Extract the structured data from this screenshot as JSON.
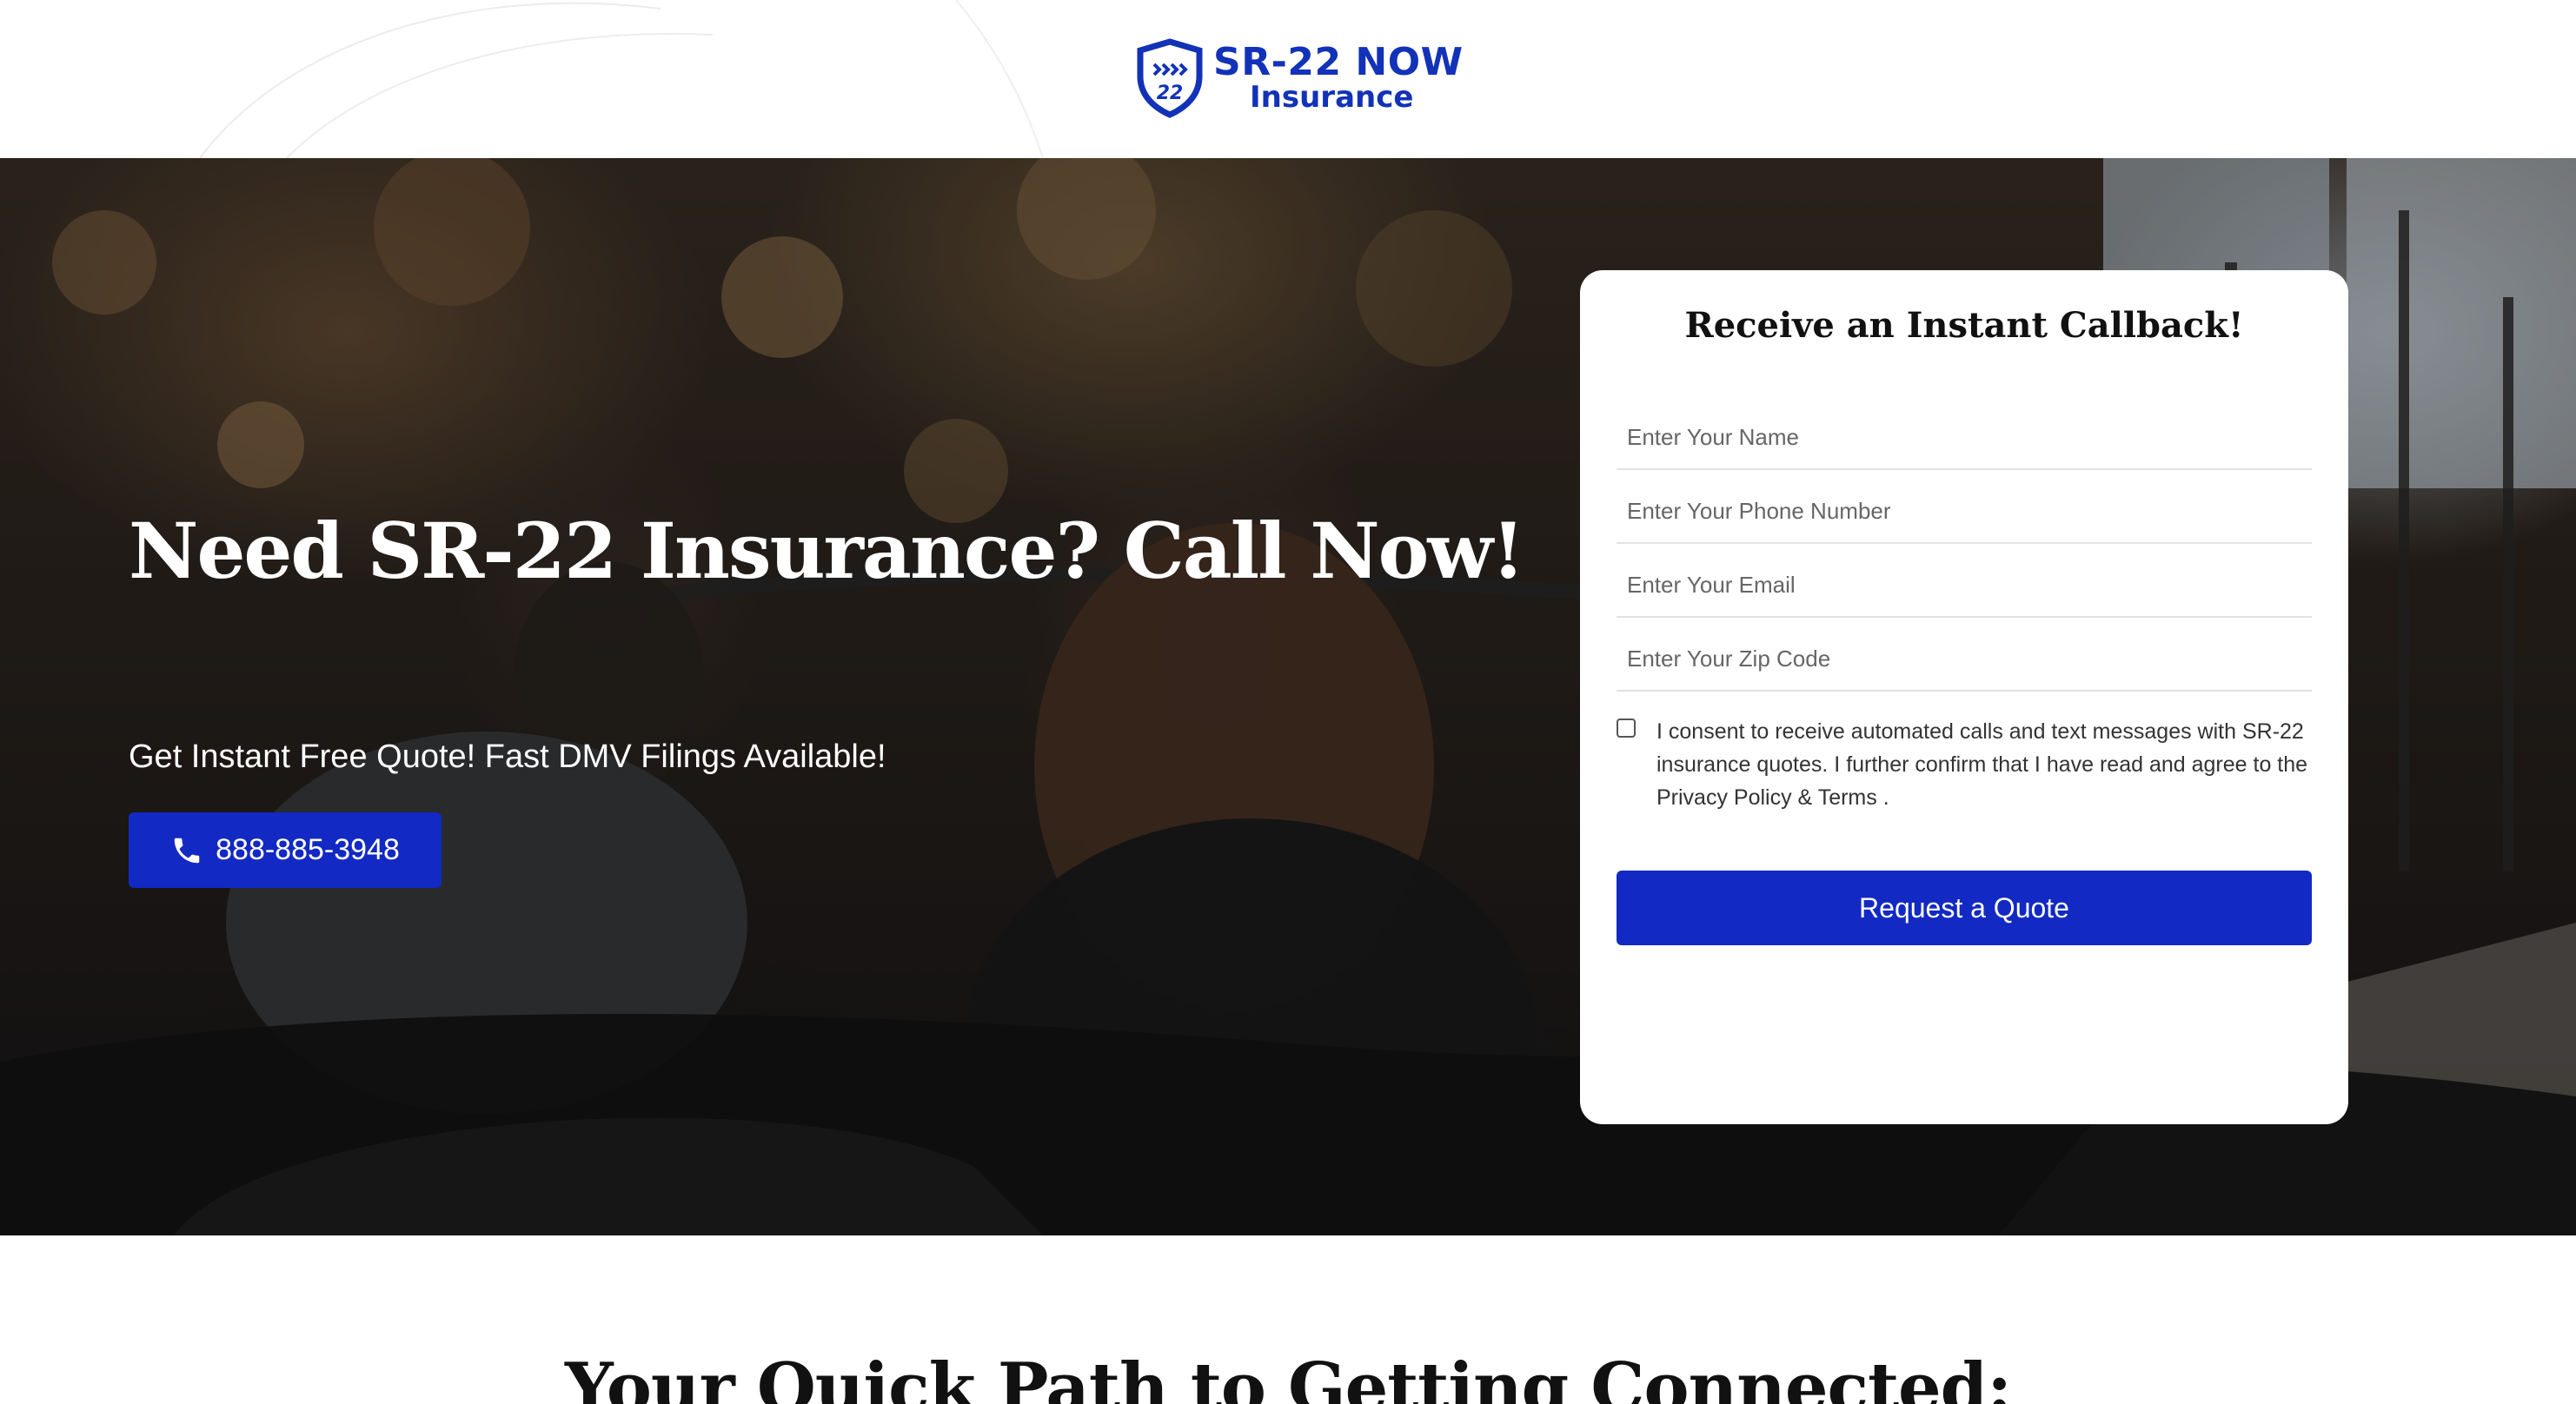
{
  "header": {
    "logo": {
      "title": "SR-22 NOW",
      "subtitle": "Insurance",
      "shield_text": "22",
      "brand_color": "#1232b8"
    }
  },
  "hero": {
    "title": "Need SR-22 Insurance? Call Now!",
    "subtitle": "Get Instant Free Quote! Fast DMV Filings Available!",
    "call_button": {
      "icon": "phone-icon",
      "label": "888-885-3948"
    }
  },
  "form": {
    "title": "Receive an Instant Callback!",
    "fields": {
      "name": {
        "placeholder": "Enter Your Name",
        "value": ""
      },
      "phone": {
        "placeholder": "Enter Your Phone Number",
        "value": ""
      },
      "email": {
        "placeholder": "Enter Your Email",
        "value": ""
      },
      "zip": {
        "placeholder": "Enter Your Zip Code",
        "value": ""
      }
    },
    "consent_text": "I consent to receive automated calls and text messages with SR-22 insurance quotes. I further confirm that I have read and agree to the Privacy Policy & Terms .",
    "submit_label": "Request a Quote",
    "accent_color": "#1229c4"
  },
  "section": {
    "title": "Your Quick Path to Getting Connected:"
  }
}
